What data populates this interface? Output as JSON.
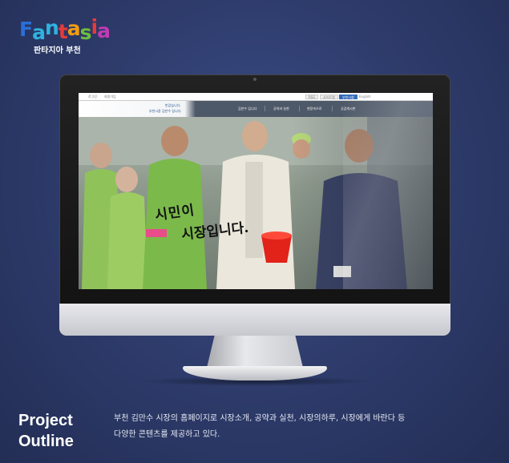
{
  "logo": {
    "wordmark_letters": [
      "F",
      "a",
      "n",
      "t",
      "a",
      "s",
      "i",
      "a"
    ],
    "letter_colors": [
      "#2a6fd6",
      "#2fb3e0",
      "#2fb3e0",
      "#e83a3a",
      "#f39c12",
      "#6cbf3c",
      "#e83a3a",
      "#c13bb4"
    ],
    "subtitle": "판타지아 부천"
  },
  "monitor": {
    "site": {
      "top_links": [
        "로그인",
        "회원가입"
      ],
      "top_buttons": [
        "RSS",
        "사이트맵",
        "부천시청",
        "English"
      ],
      "brand_line1": "반갑습니다.",
      "brand_line2": "부천시장 김만수 입니다.",
      "menu": [
        "김만수 입니다",
        "공약과 실천",
        "현장속으로",
        "공감게시판"
      ]
    },
    "hero": {
      "slogan_line1": "시민이",
      "slogan_line2": "시장입니다."
    }
  },
  "outline": {
    "title_line1": "Project",
    "title_line2": "Outline",
    "desc_line1": "부천 김만수 시장의 홈페이지로 시장소개, 공약과 실천, 시장의하루, 시장에게 바란다 등",
    "desc_line2": "다양한 콘텐츠를 제공하고 있다."
  }
}
